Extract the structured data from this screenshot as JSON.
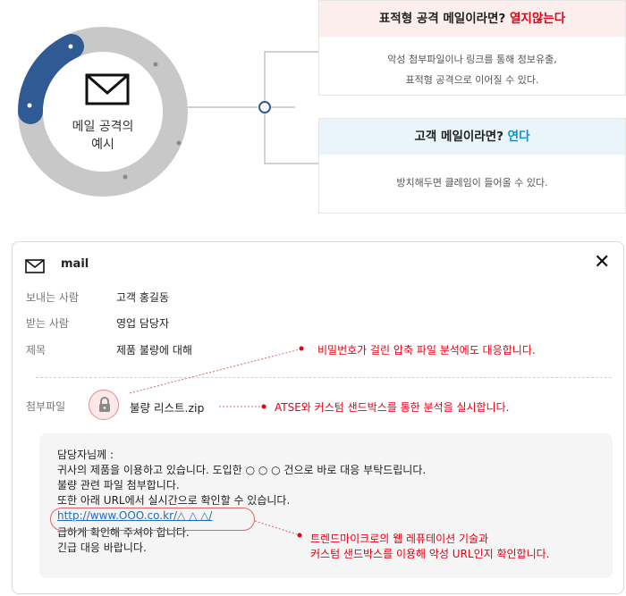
{
  "diagram": {
    "ring_label_line1": "메일 공격의",
    "ring_label_line2": "예시",
    "card1": {
      "heading_prefix": "표적형 공격 메일이라면? ",
      "heading_highlight": "열지않는다",
      "line1": "악성 첨부파일이나 링크를 통해 정보유출,",
      "line2": "표적형 공격으로 이어질 수 있다."
    },
    "card2": {
      "heading_prefix": "고객 메일이라면? ",
      "heading_highlight": "연다",
      "line1": "방치해두면 클레임이 들어올 수 있다."
    },
    "colors": {
      "ring_gray": "#c8c8c8",
      "ring_blue": "#2f5a93",
      "card1_head_bg": "#fdeeee",
      "card2_head_bg": "#eaf5fb",
      "red": "#e60012",
      "blue": "#0096d6"
    }
  },
  "mail": {
    "title": "mail",
    "close_icon": "close-icon",
    "fields": {
      "from_label": "보내는 사람",
      "from_value": "고객 홍길동",
      "to_label": "받는 사람",
      "to_value": "영업 담당자",
      "subject_label": "제목",
      "subject_value": "제품 불량에 대해",
      "attachment_label": "첨부파일",
      "attachment_value": "불량 리스트.zip"
    },
    "notes": {
      "note1": "비밀번호가 걸린 압축 파일 분석에도 대응합니다.",
      "note2": "ATSE와 커스텀 샌드박스를 통한 분석을 실시합니다.",
      "note3_line1": "트렌드마이크로의 웹 레퓨테이션 기술과",
      "note3_line2": "커스텀 샌드박스를 이용해 악성 URL인지 확인합니다."
    },
    "body": {
      "line1": "담당자님께 :",
      "line2": "귀사의 제품을 이용하고 있습니다. 도입한 ○ ○ ○ 건으로 바로 대응 부탁드립니다.",
      "line3": "불량 관련 파일 첨부합니다.",
      "line4": "또한 아래 URL에서 실시간으로 확인할 수 있습니다.",
      "url": "http://www.OOO.co.kr/△ △ △/",
      "line6": "급하게 확인해 주셔야 합니다.",
      "line7": "긴급 대응 바랍니다."
    }
  }
}
